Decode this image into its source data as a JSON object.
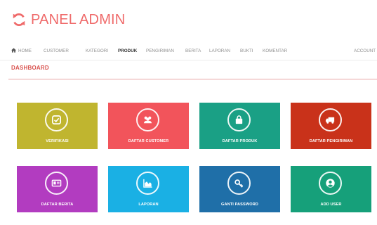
{
  "brand": {
    "title": "PANEL ADMIN",
    "color": "#ef6a6a",
    "icon": "refresh-icon"
  },
  "nav": {
    "items": [
      {
        "label": "HOME",
        "icon": "home-icon",
        "active": false
      },
      {
        "label": "CUSTOMER",
        "active": false
      },
      {
        "label": "KATEGORI",
        "active": false
      },
      {
        "label": "PRODUK",
        "active": true
      },
      {
        "label": "PENGIRIMAN",
        "active": false
      },
      {
        "label": "BERITA",
        "active": false
      },
      {
        "label": "LAPORAN",
        "active": false
      },
      {
        "label": "BUKTI",
        "active": false
      },
      {
        "label": "KOMENTAR",
        "active": false
      },
      {
        "label": "ACCOUNT",
        "active": false
      }
    ]
  },
  "dashboard": {
    "title": "DASHBOARD",
    "tiles": [
      {
        "label": "VERIFIKASI",
        "icon": "checkbox-icon",
        "color": "#c0b52f"
      },
      {
        "label": "DAFTAR CUSTOMER",
        "icon": "users-icon",
        "color": "#f2545b"
      },
      {
        "label": "DAFTAR PRODUK",
        "icon": "shopping-bag-icon",
        "color": "#1aa085"
      },
      {
        "label": "DAFTAR PENGIRIMAN",
        "icon": "truck-icon",
        "color": "#c9321a"
      },
      {
        "label": "DAFTAR BERITA",
        "icon": "id-card-icon",
        "color": "#b23cc0"
      },
      {
        "label": "LAPORAN",
        "icon": "area-chart-icon",
        "color": "#1ab0e4"
      },
      {
        "label": "GANTI PASSWORD",
        "icon": "key-icon",
        "color": "#1f6fa8"
      },
      {
        "label": "ADD USER",
        "icon": "user-circle-icon",
        "color": "#16a07a"
      }
    ]
  }
}
